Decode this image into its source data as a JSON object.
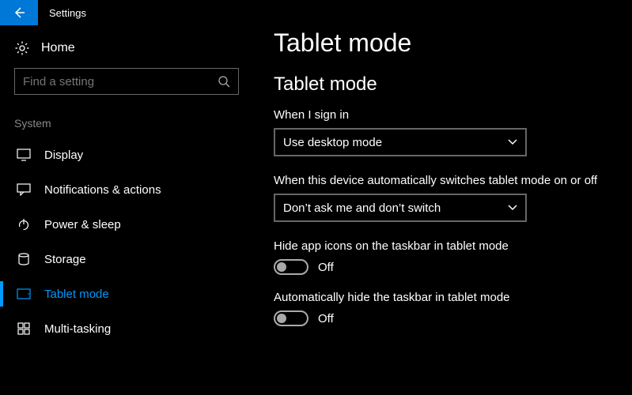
{
  "app": {
    "title": "Settings"
  },
  "sidebar": {
    "home_label": "Home",
    "search_placeholder": "Find a setting",
    "group_label": "System",
    "items": [
      {
        "label": "Display"
      },
      {
        "label": "Notifications & actions"
      },
      {
        "label": "Power & sleep"
      },
      {
        "label": "Storage"
      },
      {
        "label": "Tablet mode"
      },
      {
        "label": "Multi-tasking"
      }
    ]
  },
  "page": {
    "title": "Tablet mode",
    "section_title": "Tablet mode",
    "sign_in": {
      "label": "When I sign in",
      "value": "Use desktop mode"
    },
    "auto_switch": {
      "label": "When this device automatically switches tablet mode on or off",
      "value": "Don’t ask me and don’t switch"
    },
    "hide_icons": {
      "label": "Hide app icons on the taskbar in tablet mode",
      "state": "Off"
    },
    "hide_taskbar": {
      "label": "Automatically hide the taskbar in tablet mode",
      "state": "Off"
    }
  }
}
